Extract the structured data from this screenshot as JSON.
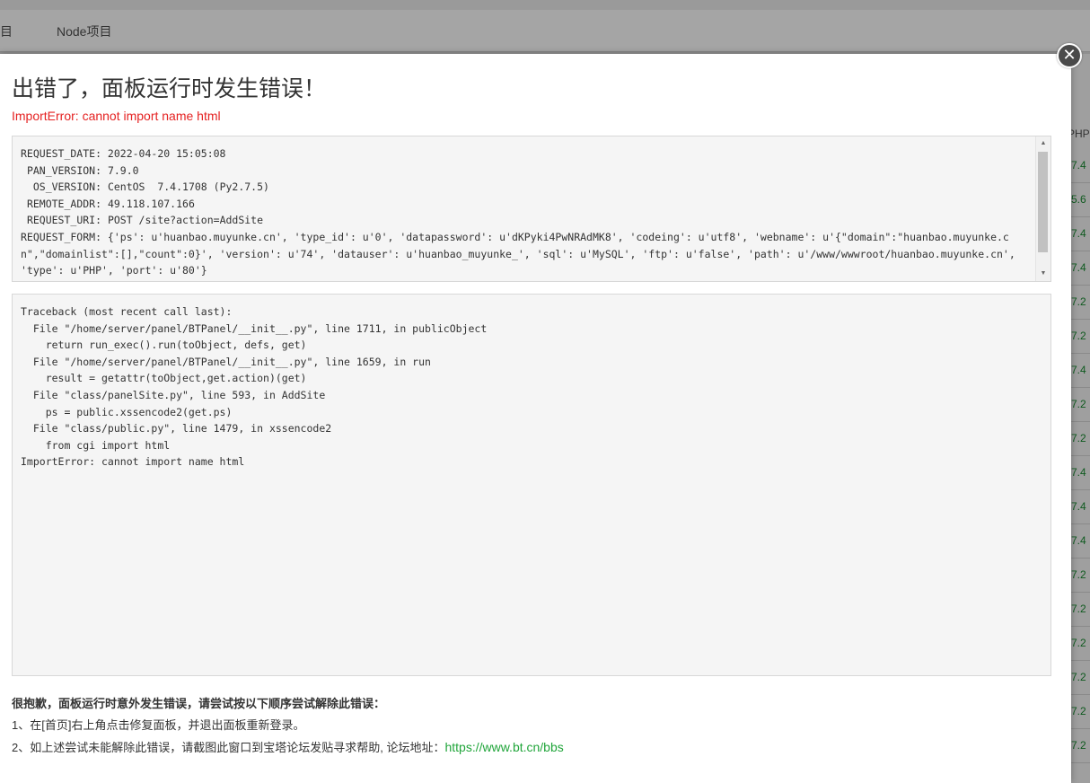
{
  "background": {
    "tabs": [
      "目",
      "Node项目"
    ],
    "php_column_header": "PHP",
    "php_versions": [
      "7.4",
      "5.6",
      "7.4",
      "7.4",
      "7.2",
      "7.2",
      "7.4",
      "7.2",
      "7.2",
      "7.4",
      "7.4",
      "7.4",
      "7.2",
      "7.2",
      "7.2",
      "7.2",
      "7.2",
      "7.2"
    ]
  },
  "modal": {
    "title": "出错了，面板运行时发生错误！",
    "error_message": "ImportError: cannot import name html",
    "request_info": "REQUEST_DATE: 2022-04-20 15:05:08\n PAN_VERSION: 7.9.0\n  OS_VERSION: CentOS  7.4.1708 (Py2.7.5)\n REMOTE_ADDR: 49.118.107.166\n REQUEST_URI: POST /site?action=AddSite\nREQUEST_FORM: {'ps': u'huanbao.muyunke.cn', 'type_id': u'0', 'datapassword': u'dKPyki4PwNRAdMK8', 'codeing': u'utf8', 'webname': u'{\"domain\":\"huanbao.muyunke.cn\",\"domainlist\":[],\"count\":0}', 'version': u'74', 'datauser': u'huanbao_muyunke_', 'sql': u'MySQL', 'ftp': u'false', 'path': u'/www/wwwroot/huanbao.muyunke.cn', 'type': u'PHP', 'port': u'80'}",
    "traceback": "Traceback (most recent call last):\n  File \"/home/server/panel/BTPanel/__init__.py\", line 1711, in publicObject\n    return run_exec().run(toObject, defs, get)\n  File \"/home/server/panel/BTPanel/__init__.py\", line 1659, in run\n    result = getattr(toObject,get.action)(get)\n  File \"class/panelSite.py\", line 593, in AddSite\n    ps = public.xssencode2(get.ps)\n  File \"class/public.py\", line 1479, in xssencode2\n    from cgi import html\nImportError: cannot import name html",
    "help_heading": "很抱歉，面板运行时意外发生错误，请尝试按以下顺序尝试解除此错误：",
    "help_step1": "1、在[首页]右上角点击修复面板，并退出面板重新登录。",
    "help_step2": "2、如上述尝试未能解除此错误，请截图此窗口到宝塔论坛发贴寻求帮助, 论坛地址：",
    "forum_link": "https://www.bt.cn/bbs",
    "close_icon": "close-icon"
  },
  "colors": {
    "error_red": "#e52222",
    "link_green": "#20a53a"
  }
}
